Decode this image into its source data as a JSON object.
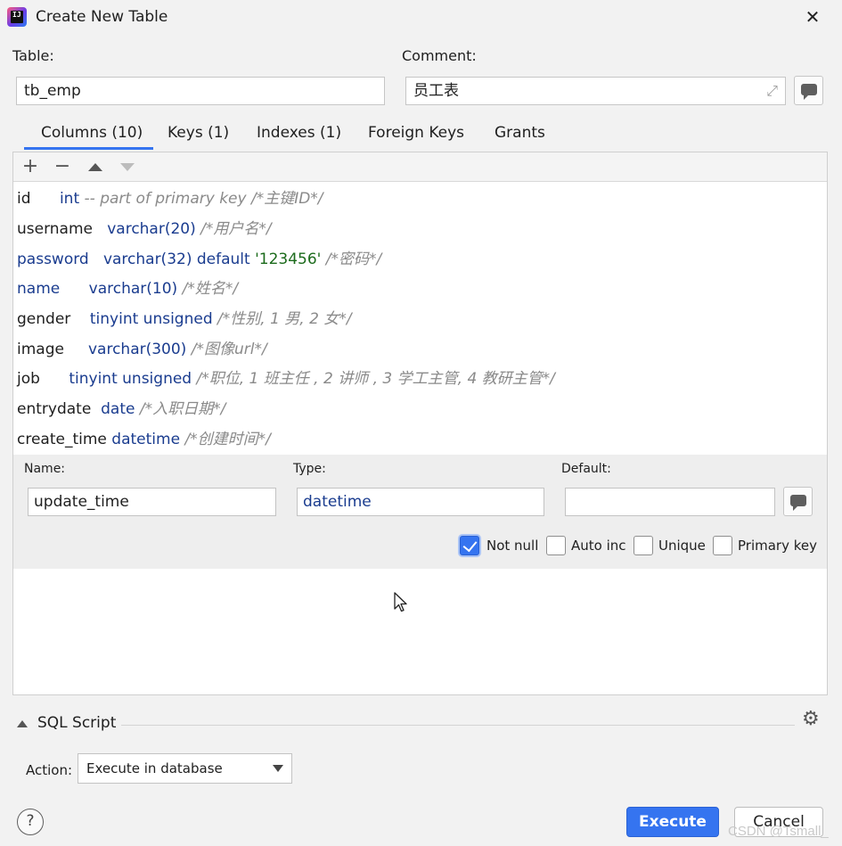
{
  "window": {
    "title": "Create New Table",
    "close_label": "✕"
  },
  "table": {
    "label": "Table:",
    "value": "tb_emp"
  },
  "comment": {
    "label": "Comment:",
    "value": "员工表"
  },
  "tabs": [
    {
      "label": "Columns (10)",
      "active": true
    },
    {
      "label": "Keys (1)",
      "active": false
    },
    {
      "label": "Indexes (1)",
      "active": false
    },
    {
      "label": "Foreign Keys",
      "active": false
    },
    {
      "label": "Grants",
      "active": false
    }
  ],
  "toolbar": {
    "add": "+",
    "remove": "−"
  },
  "columns": [
    {
      "name": "id",
      "type": "int",
      "default": "",
      "comment": "-- part of primary key /*主键ID*/"
    },
    {
      "name": "username",
      "type": "varchar(20)",
      "default": "",
      "comment": "/*用户名*/"
    },
    {
      "name": "password",
      "type": "varchar(32) default ",
      "default": "'123456'",
      "comment": "/*密码*/"
    },
    {
      "name": "name",
      "type": "varchar(10)",
      "default": "",
      "comment": "/*姓名*/"
    },
    {
      "name": "gender",
      "type": "tinyint unsigned",
      "default": "",
      "comment": "/*性别, 1 男, 2 女*/"
    },
    {
      "name": "image",
      "type": "varchar(300)",
      "default": "",
      "comment": "/*图像url*/"
    },
    {
      "name": "job",
      "type": "tinyint unsigned",
      "default": "",
      "comment": "/*职位, 1 班主任 , 2 讲师 , 3 学工主管, 4 教研主管*/"
    },
    {
      "name": "entrydate",
      "type": "date",
      "default": "",
      "comment": "/*入职日期*/"
    },
    {
      "name": "create_time",
      "type": "datetime",
      "default": "",
      "comment": "/*创建时间*/"
    }
  ],
  "editor": {
    "name_label": "Name:",
    "name_value": "update_time",
    "type_label": "Type:",
    "type_value": "datetime",
    "default_label": "Default:",
    "default_value": "",
    "options": [
      {
        "label": "Not null",
        "checked": true
      },
      {
        "label": "Auto inc",
        "checked": false
      },
      {
        "label": "Unique",
        "checked": false
      },
      {
        "label": "Primary key",
        "checked": false
      }
    ]
  },
  "sql_script": {
    "title": "SQL Script",
    "action_label": "Action:",
    "action_value": "Execute in database"
  },
  "buttons": {
    "help": "?",
    "execute": "Execute",
    "cancel": "Cancel"
  },
  "watermark": "CSDN @Tsmall_",
  "colors": {
    "accent": "#3574f0",
    "type_blue": "#1a3c8f",
    "string_green": "#1c6b1c",
    "comment_gray": "#8a8a8a"
  }
}
